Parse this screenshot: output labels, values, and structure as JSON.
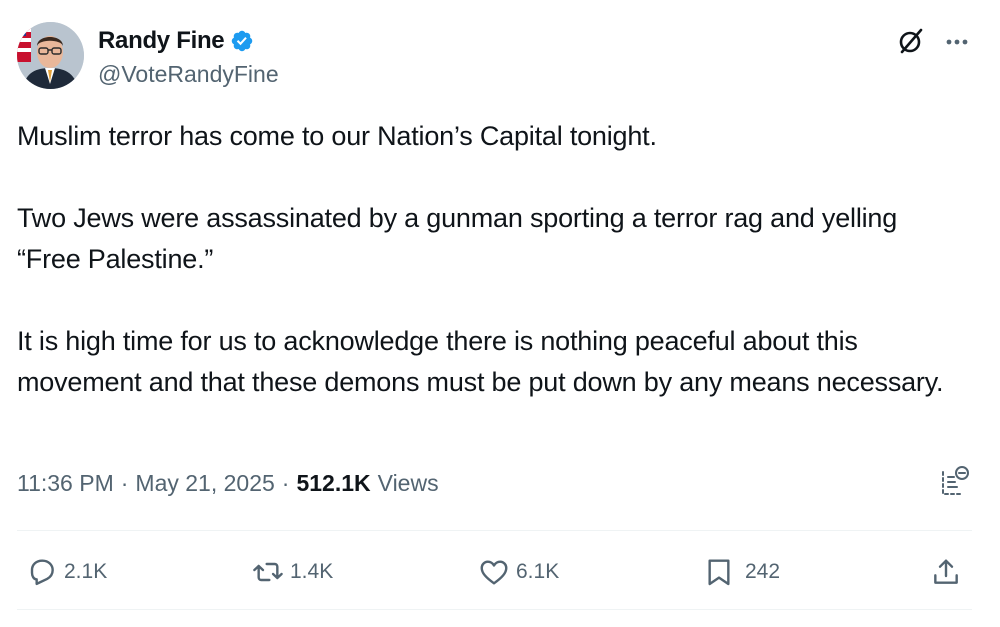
{
  "author": {
    "name": "Randy Fine",
    "handle": "@VoteRandyFine",
    "verified": true
  },
  "post": {
    "paragraphs": [
      "Muslim terror has come to our Nation’s Capital tonight.",
      "Two Jews were assassinated by a gunman sporting a terror rag and yelling “Free Palestine.”",
      "It is high time for us to acknowledge there is nothing peaceful about this movement and that these demons must be put down by any means necessary."
    ],
    "time": "11:36 PM",
    "date": "May 21, 2025",
    "views_count": "512.1K",
    "views_label": "Views"
  },
  "actions": {
    "replies": "2.1K",
    "reposts": "1.4K",
    "likes": "6.1K",
    "bookmarks": "242"
  },
  "icons": {
    "verified": "verified-badge-icon",
    "grok": "grok-icon",
    "more": "more-options-icon",
    "analytics": "post-analytics-icon",
    "reply": "reply-icon",
    "repost": "repost-icon",
    "like": "like-icon",
    "bookmark": "bookmark-icon",
    "share": "share-icon"
  },
  "colors": {
    "text_primary": "#0f1419",
    "text_secondary": "#536471",
    "verified_blue": "#1d9bf0",
    "divider": "#eff3f4"
  }
}
